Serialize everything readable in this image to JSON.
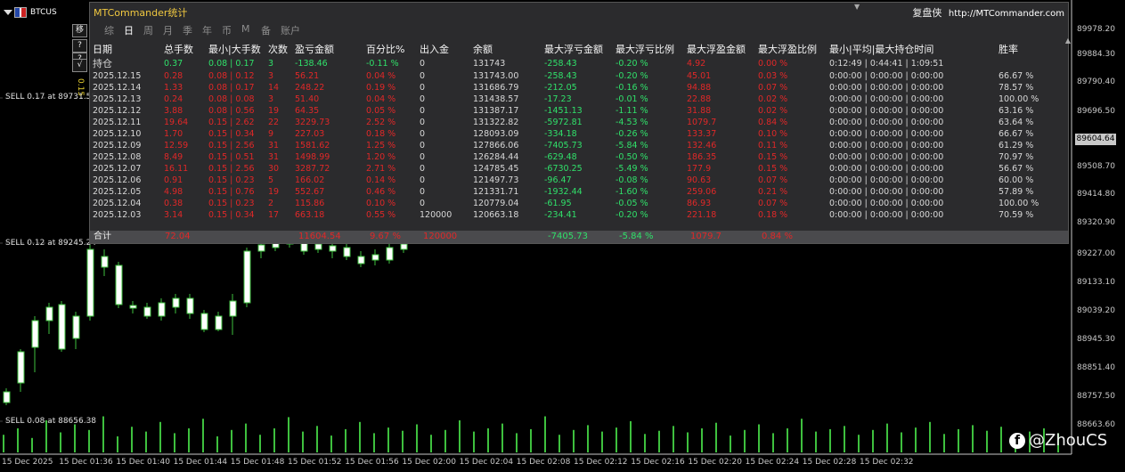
{
  "symbol": {
    "name": "BTCUSD",
    "short": "BTCUS"
  },
  "side_buttons": [
    "移",
    "?",
    "?",
    "√"
  ],
  "side_vertical_label": "0.15",
  "price_axis": [
    "89978.20",
    "89884.30",
    "89790.40",
    "89696.50",
    "89604.64",
    "89508.70",
    "89414.80",
    "89320.90",
    "89227.00",
    "89133.10",
    "89039.20",
    "88945.30",
    "88851.40",
    "88757.50",
    "88663.60"
  ],
  "current_price_tag": "89604.64",
  "time_axis": [
    "15 Dec 2025",
    "15 Dec 01:36",
    "15 Dec 01:40",
    "15 Dec 01:44",
    "15 Dec 01:48",
    "15 Dec 01:52",
    "15 Dec 01:56",
    "15 Dec 02:00",
    "15 Dec 02:04",
    "15 Dec 02:08",
    "15 Dec 02:12",
    "15 Dec 02:16",
    "15 Dec 02:20",
    "15 Dec 02:24",
    "15 Dec 02:28",
    "15 Dec 02:32"
  ],
  "order_labels": [
    "SELL 0.17 at 89731.55",
    "SELL 0.12 at 89245.24",
    "SELL 0.08 at 88656.38"
  ],
  "panel": {
    "title": "MTCommander统计",
    "brand": "复盘侠",
    "url": "http://MTCommander.com",
    "tabs": [
      "综",
      "日",
      "周",
      "月",
      "季",
      "年",
      "币",
      "M",
      "备",
      "账户"
    ],
    "active_tab": "日",
    "headers": [
      "日期",
      "总手数",
      "最小|大手数",
      "次数",
      "盈亏金额",
      "百分比%",
      "出入金",
      "余额",
      "最大浮亏金额",
      "最大浮亏比例",
      "最大浮盈金额",
      "最大浮盈比例",
      "最小|平均|最大持仓时间",
      "胜率"
    ],
    "holding": [
      "持仓",
      "0.37",
      "0.08 | 0.17",
      "3",
      "-138.46",
      "-0.11 %",
      "0",
      "131743",
      "-258.43",
      "-0.20 %",
      "4.92",
      "0.00 %",
      "0:12:49 | 0:44:41 | 1:09:51",
      ""
    ],
    "rows": [
      [
        "2025.12.15",
        "0.28",
        "0.08 | 0.12",
        "3",
        "56.21",
        "0.04 %",
        "0",
        "131743.00",
        "-258.43",
        "-0.20 %",
        "45.01",
        "0.03 %",
        "0:00:00 | 0:00:00 | 0:00:00",
        "66.67 %"
      ],
      [
        "2025.12.14",
        "1.33",
        "0.08 | 0.17",
        "14",
        "248.22",
        "0.19 %",
        "0",
        "131686.79",
        "-212.05",
        "-0.16 %",
        "94.88",
        "0.07 %",
        "0:00:00 | 0:00:00 | 0:00:00",
        "78.57 %"
      ],
      [
        "2025.12.13",
        "0.24",
        "0.08 | 0.08",
        "3",
        "51.40",
        "0.04 %",
        "0",
        "131438.57",
        "-17.23",
        "-0.01 %",
        "22.88",
        "0.02 %",
        "0:00:00 | 0:00:00 | 0:00:00",
        "100.00 %"
      ],
      [
        "2025.12.12",
        "3.88",
        "0.08 | 0.56",
        "19",
        "64.35",
        "0.05 %",
        "0",
        "131387.17",
        "-1451.13",
        "-1.11 %",
        "31.88",
        "0.02 %",
        "0:00:00 | 0:00:00 | 0:00:00",
        "63.16 %"
      ],
      [
        "2025.12.11",
        "19.64",
        "0.15 | 2.62",
        "22",
        "3229.73",
        "2.52 %",
        "0",
        "131322.82",
        "-5972.81",
        "-4.53 %",
        "1079.7",
        "0.84 %",
        "0:00:00 | 0:00:00 | 0:00:00",
        "63.64 %"
      ],
      [
        "2025.12.10",
        "1.70",
        "0.15 | 0.34",
        "9",
        "227.03",
        "0.18 %",
        "0",
        "128093.09",
        "-334.18",
        "-0.26 %",
        "133.37",
        "0.10 %",
        "0:00:00 | 0:00:00 | 0:00:00",
        "66.67 %"
      ],
      [
        "2025.12.09",
        "12.59",
        "0.15 | 2.56",
        "31",
        "1581.62",
        "1.25 %",
        "0",
        "127866.06",
        "-7405.73",
        "-5.84 %",
        "132.46",
        "0.11 %",
        "0:00:00 | 0:00:00 | 0:00:00",
        "61.29 %"
      ],
      [
        "2025.12.08",
        "8.49",
        "0.15 | 0.51",
        "31",
        "1498.99",
        "1.20 %",
        "0",
        "126284.44",
        "-629.48",
        "-0.50 %",
        "186.35",
        "0.15 %",
        "0:00:00 | 0:00:00 | 0:00:00",
        "70.97 %"
      ],
      [
        "2025.12.07",
        "16.11",
        "0.15 | 2.56",
        "30",
        "3287.72",
        "2.71 %",
        "0",
        "124785.45",
        "-6730.25",
        "-5.49 %",
        "177.9",
        "0.15 %",
        "0:00:00 | 0:00:00 | 0:00:00",
        "56.67 %"
      ],
      [
        "2025.12.06",
        "0.91",
        "0.15 | 0.23",
        "5",
        "166.02",
        "0.14 %",
        "0",
        "121497.73",
        "-96.47",
        "-0.08 %",
        "90.63",
        "0.07 %",
        "0:00:00 | 0:00:00 | 0:00:00",
        "60.00 %"
      ],
      [
        "2025.12.05",
        "4.98",
        "0.15 | 0.76",
        "19",
        "552.67",
        "0.46 %",
        "0",
        "121331.71",
        "-1932.44",
        "-1.60 %",
        "259.06",
        "0.21 %",
        "0:00:00 | 0:00:00 | 0:00:00",
        "57.89 %"
      ],
      [
        "2025.12.04",
        "0.38",
        "0.15 | 0.23",
        "2",
        "115.86",
        "0.10 %",
        "0",
        "120779.04",
        "-61.95",
        "-0.05 %",
        "86.93",
        "0.07 %",
        "0:00:00 | 0:00:00 | 0:00:00",
        "100.00 %"
      ],
      [
        "2025.12.03",
        "3.14",
        "0.15 | 0.34",
        "17",
        "663.18",
        "0.55 %",
        "120000",
        "120663.18",
        "-234.41",
        "-0.20 %",
        "221.18",
        "0.18 %",
        "0:00:00 | 0:00:00 | 0:00:00",
        "70.59 %"
      ]
    ],
    "total": {
      "label": "合计",
      "lots": "72.04",
      "pnl": "11604.54",
      "pct": "9.67 %",
      "deposit": "120000",
      "max_loss": "-7405.73",
      "max_loss_pct": "-5.84 %",
      "max_gain": "1079.7",
      "max_gain_pct": "0.84 %"
    }
  },
  "bottom_brand": {
    "handle": "@ZhouCS"
  },
  "colors": {
    "panel_title": "#f0c840",
    "profit": "#e02828",
    "loss": "#30e06a",
    "candle": "#3ec03e",
    "neutral": "#d8d8d8"
  }
}
